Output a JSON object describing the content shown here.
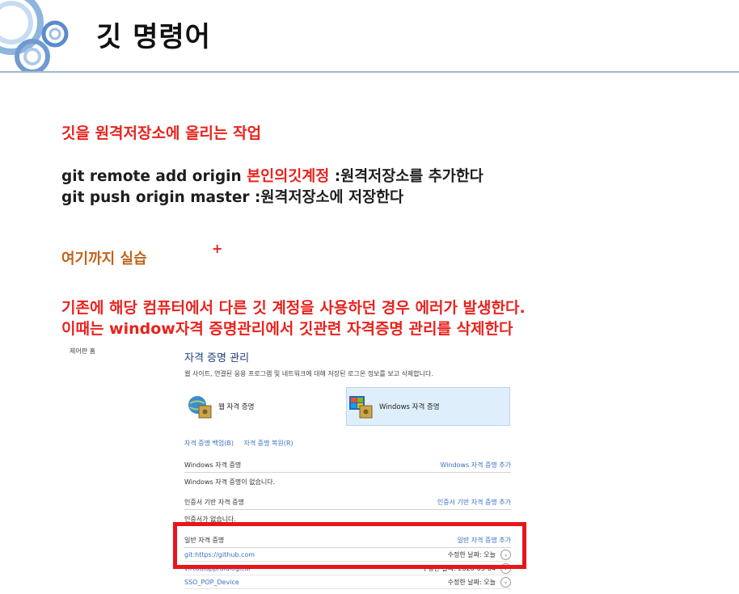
{
  "slide": {
    "title": "깃 명령어",
    "section_heading": "깃을 원격저장소에 올리는 작업",
    "command1": {
      "code": "git remote add origin",
      "highlight": "본인의깃계정",
      "desc": " :원격저장소를 추가한다"
    },
    "command2": {
      "code": "git push origin master",
      "desc": " :원격저장소에 저장한다"
    },
    "practice_label": "여기까지 실습",
    "plus_mark": "+",
    "warning_line1": "기존에 해당 컴퓨터에서 다른 깃 계정을 사용하던 경우 에러가 발생한다.",
    "warning_line2": "이때는 window자격 증명관리에서 깃관련 자격증명 관리를 삭제한다",
    "colors": {
      "red": "#e8231d",
      "orange": "#c0631a",
      "accent_blue": "#3b6fc1"
    }
  },
  "credential_manager": {
    "control_panel_home": "제어판 홈",
    "title": "자격 증명 관리",
    "description": "웹 사이트, 연결된 응용 프로그램 및 네트워크에 대해 저장된 로그온 정보를 보고 삭제합니다.",
    "web_credentials": "웹 자격 증명",
    "windows_credentials": "Windows 자격 증명",
    "backup_link": "자격 증명 백업(B)",
    "restore_link": "자격 증명 복원(R)",
    "windows_section": {
      "header": "Windows 자격 증명",
      "add": "Windows 자격 증명 추가",
      "empty": "Windows 자격 증명이 없습니다."
    },
    "certificate_section": {
      "header": "인증서 기반 자격 증명",
      "add": "인증서 기반 자격 증명 추가",
      "empty": "인증서가 없습니다."
    },
    "generic_section": {
      "header": "일반 자격 증명",
      "add": "일반 자격 증명 추가",
      "rows": [
        {
          "name": "git:https://github.com",
          "modified": "수정한 날짜: 오늘"
        },
        {
          "name": "virtualapp/didlogical",
          "modified": "수정한 날짜: 2020-05-04"
        },
        {
          "name": "SSO_POP_Device",
          "modified": "수정한 날짜: 오늘"
        }
      ]
    },
    "icons": [
      "globe-vault-icon",
      "windows-vault-icon",
      "expand-chevron-icon"
    ]
  }
}
